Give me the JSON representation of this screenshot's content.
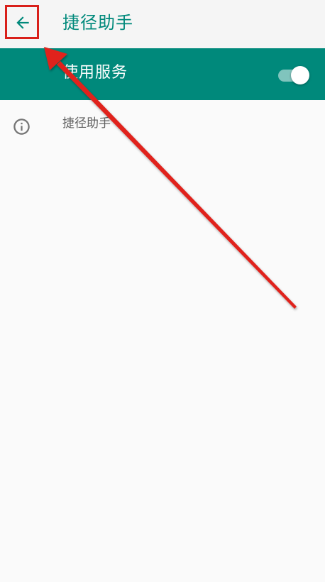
{
  "appbar": {
    "title": "捷径助手",
    "back_icon": "arrow-left-icon"
  },
  "master_switch": {
    "label": "使用服务",
    "enabled": true,
    "accent_color": "#00897b"
  },
  "info_row": {
    "icon": "info-icon",
    "text": "捷径助手"
  },
  "annotation": {
    "color": "#e0201a"
  }
}
